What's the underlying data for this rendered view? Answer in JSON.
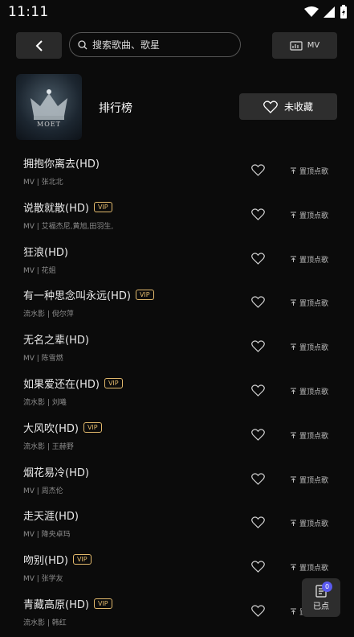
{
  "status_bar": {
    "time": "11:11"
  },
  "search": {
    "placeholder": "搜索歌曲、歌星"
  },
  "mv_button": {
    "label": "MV"
  },
  "header": {
    "title": "排行榜",
    "cover_text": "MOET",
    "favorite_label": "未收藏"
  },
  "pin_label": "置顶点歌",
  "vip_label": "VIP",
  "songs": [
    {
      "title": "拥抱你离去(HD)",
      "vip": false,
      "subtitle": "MV | 张北北"
    },
    {
      "title": "说散就散(HD)",
      "vip": true,
      "subtitle": "MV | 艾福杰尼,黄旭,田羽生,"
    },
    {
      "title": "狂浪(HD)",
      "vip": false,
      "subtitle": "MV | 花姐"
    },
    {
      "title": "有一种思念叫永远(HD)",
      "vip": true,
      "subtitle": "流水影 | 倪尔萍"
    },
    {
      "title": "无名之辈(HD)",
      "vip": false,
      "subtitle": "MV | 陈雪燃"
    },
    {
      "title": "如果爱还在(HD)",
      "vip": true,
      "subtitle": "流水影 | 刘曦"
    },
    {
      "title": "大风吹(HD)",
      "vip": true,
      "subtitle": "流水影 | 王赫野"
    },
    {
      "title": "烟花易冷(HD)",
      "vip": false,
      "subtitle": "MV | 周杰伦"
    },
    {
      "title": "走天涯(HD)",
      "vip": false,
      "subtitle": "MV | 降央卓玛"
    },
    {
      "title": "吻别(HD)",
      "vip": true,
      "subtitle": "MV | 张学友"
    },
    {
      "title": "青藏高原(HD)",
      "vip": true,
      "subtitle": "流水影 | 韩红"
    }
  ],
  "queue": {
    "label": "已点",
    "count": "0"
  },
  "colors": {
    "vip": "#e2b96c",
    "badge": "#5a5af0",
    "background": "#0b0b0b"
  }
}
